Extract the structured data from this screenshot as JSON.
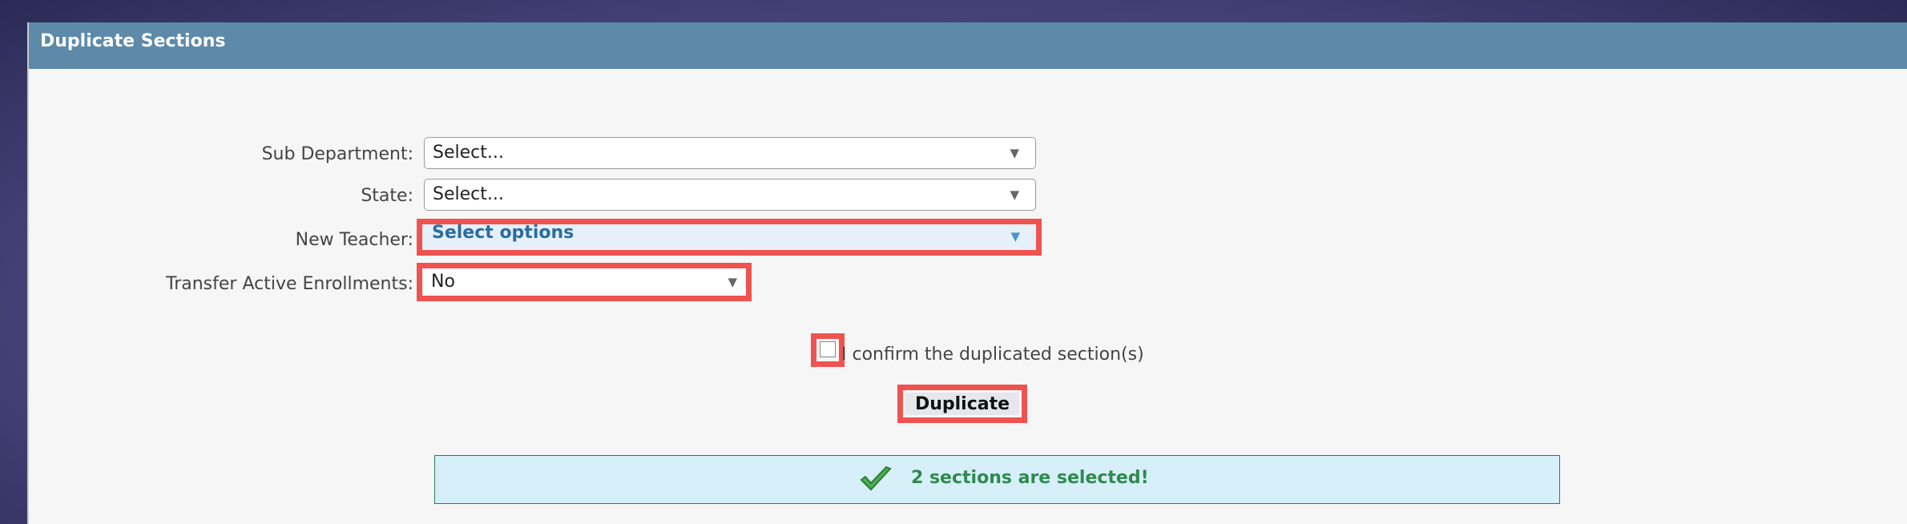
{
  "dialog": {
    "title": "Duplicate Sections"
  },
  "form": {
    "sub_department_label": "Sub Department:",
    "sub_department_value": "Select...",
    "state_label": "State:",
    "state_value": "Select...",
    "new_teacher_label": "New Teacher:",
    "new_teacher_value": "Select options",
    "transfer_label": "Transfer Active Enrollments:",
    "transfer_value": "No",
    "confirm_text": "I confirm the duplicated section(s)",
    "duplicate_label": "Duplicate"
  },
  "notice": {
    "text": "2 sections are selected!"
  },
  "colors": {
    "title_bar": "#5d8aa9",
    "highlight": "#ef5350",
    "notice_bg": "#d6eff9",
    "notice_text": "#2f8a4e"
  },
  "icons": {
    "dropdown": "chevron-down-icon",
    "success": "checkmark-icon"
  }
}
